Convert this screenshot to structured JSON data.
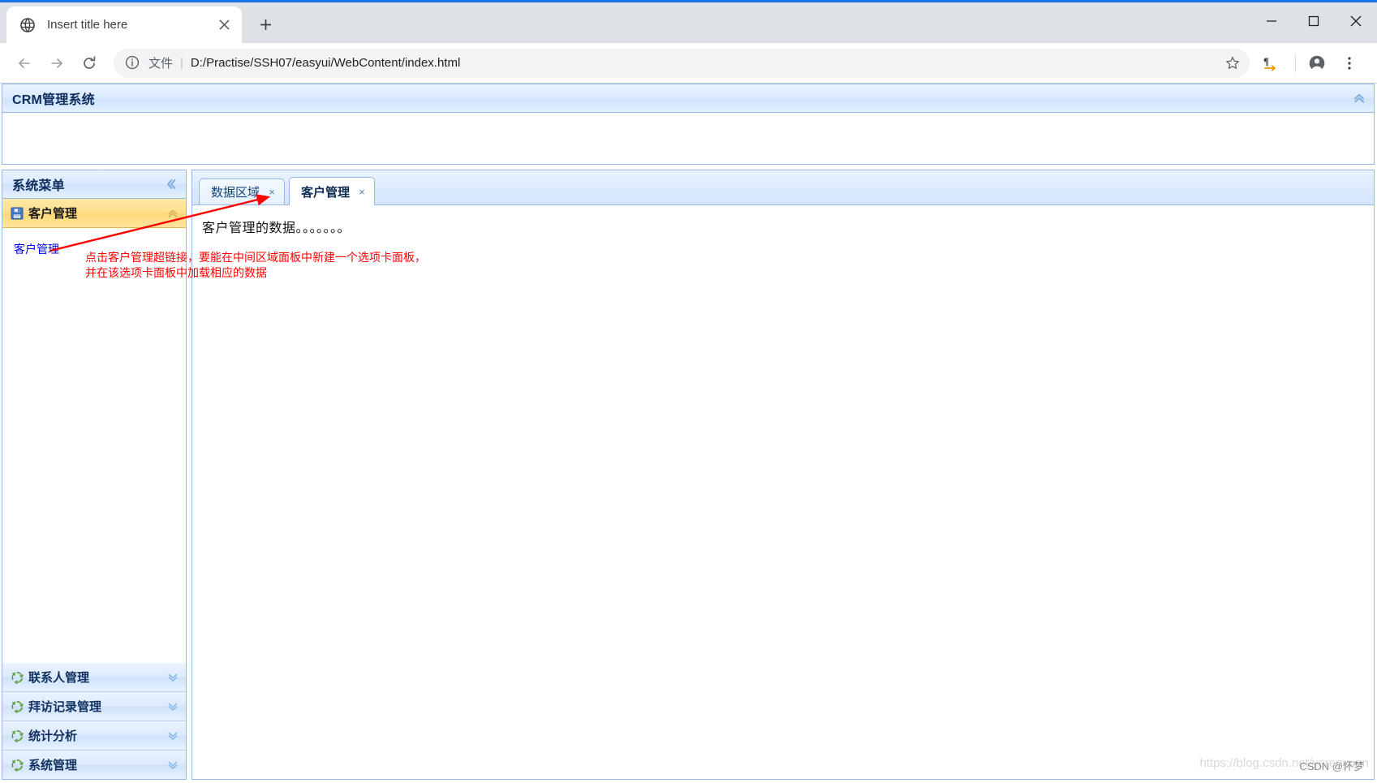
{
  "browser": {
    "tab": {
      "title": "Insert title here",
      "favicon": "globe-icon",
      "close": "×"
    },
    "new_tab_label": "+",
    "window_controls": {
      "minimize": "—",
      "maximize": "☐",
      "close": "✕"
    },
    "toolbar": {
      "back": "←",
      "forward": "→",
      "reload": "⟳",
      "info_icon": "info-circle-icon",
      "scheme_label": "文件",
      "separator": "|",
      "url": "D:/Practise/SSH07/easyui/WebContent/index.html",
      "star": "☆",
      "translate": "¶",
      "profile": "profile-icon",
      "menu": "⋮"
    }
  },
  "app": {
    "header": {
      "title": "CRM管理系统",
      "collapse_icon": "«"
    },
    "sidebar": {
      "title": "系统菜单",
      "collapse_icon": "«",
      "items": [
        {
          "label": "客户管理",
          "icon": "save-disk-icon",
          "arrow": "«",
          "selected": true
        },
        {
          "label": "联系人管理",
          "icon": "recycle-icon",
          "arrow": "»",
          "selected": false
        },
        {
          "label": "拜访记录管理",
          "icon": "recycle-icon",
          "arrow": "»",
          "selected": false
        },
        {
          "label": "统计分析",
          "icon": "recycle-icon",
          "arrow": "»",
          "selected": false
        },
        {
          "label": "系统管理",
          "icon": "recycle-icon",
          "arrow": "»",
          "selected": false
        }
      ],
      "body_link": "客户管理"
    },
    "center": {
      "tabs": [
        {
          "label": "数据区域",
          "close": "×",
          "active": false
        },
        {
          "label": "客户管理",
          "close": "×",
          "active": true
        }
      ],
      "panel_text": "客户管理的数据。。。。。。。"
    },
    "annotation": {
      "line1": "点击客户管理超链接，要能在中间区域面板中新建一个选项卡面板，",
      "line2": "并在该选项卡面板中加载相应的数据",
      "color": "#ff0000"
    },
    "watermark": {
      "url": "https://blog.csdn.net/yerenyuan",
      "credit": "CSDN @怀梦"
    }
  }
}
